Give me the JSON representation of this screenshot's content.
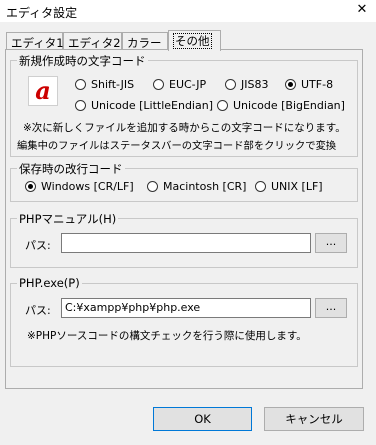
{
  "window": {
    "title": "エディタ設定",
    "close_glyph": "✕"
  },
  "tabs": [
    {
      "label": "エディタ1"
    },
    {
      "label": "エディタ2"
    },
    {
      "label": "カラー"
    },
    {
      "label": "その他"
    }
  ],
  "encoding": {
    "legend": "新規作成時の文字コード",
    "options": [
      "Shift-JIS",
      "EUC-JP",
      "JIS83",
      "UTF-8",
      "Unicode [LittleEndian]",
      "Unicode [BigEndian]"
    ],
    "selected": "UTF-8",
    "note1": "※次に新しくファイルを追加する時からこの文字コードになります。",
    "note2": "編集中のファイルはステータスバーの文字コード部をクリックで変換",
    "icon_letter": "a",
    "icon_color": "#cc0000"
  },
  "linebreak": {
    "legend": "保存時の改行コード",
    "options": [
      "Windows [CR/LF]",
      "Macintosh [CR]",
      "UNIX [LF]"
    ],
    "selected": "Windows [CR/LF]"
  },
  "php_manual": {
    "legend": "PHPマニュアル(H)",
    "path_label": "パス:",
    "path_value": "",
    "browse_label": "..."
  },
  "php_exe": {
    "legend": "PHP.exe(P)",
    "path_label": "パス:",
    "path_value": "C:¥xampp¥php¥php.exe",
    "browse_label": "...",
    "note": "※PHPソースコードの構文チェックを行う際に使用します。"
  },
  "buttons": {
    "ok": "OK",
    "cancel": "キャンセル"
  },
  "colors": {
    "accent": "#0078d7",
    "dialog_bg": "#f0f0f0"
  }
}
